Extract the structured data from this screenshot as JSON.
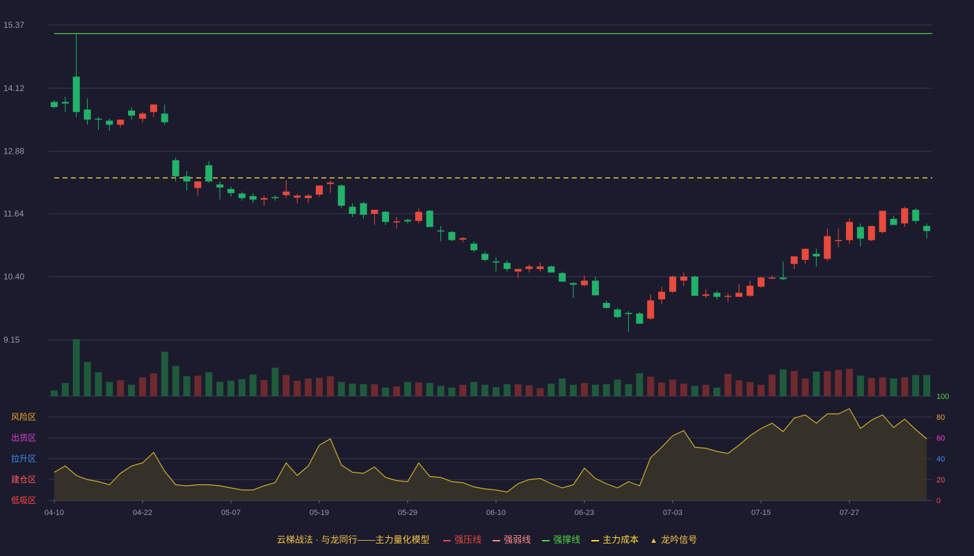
{
  "chart_data": {
    "type": "candlestick",
    "price_axis": {
      "ticks": [
        "15.37",
        "14.12",
        "12.88",
        "11.64",
        "10.40",
        "9.15"
      ],
      "range": [
        9.15,
        15.37
      ]
    },
    "dates": [
      "04-10",
      "04-11",
      "04-14",
      "04-15",
      "04-16",
      "04-17",
      "04-18",
      "04-21",
      "04-22",
      "04-23",
      "04-24",
      "04-25",
      "04-28",
      "04-29",
      "04-30",
      "05-06",
      "05-07",
      "05-08",
      "05-09",
      "05-12",
      "05-13",
      "05-14",
      "05-15",
      "05-16",
      "05-19",
      "05-20",
      "05-21",
      "05-22",
      "05-23",
      "05-26",
      "05-27",
      "05-28",
      "05-29",
      "05-30",
      "06-03",
      "06-04",
      "06-05",
      "06-06",
      "06-09",
      "06-10",
      "06-11",
      "06-12",
      "06-13",
      "06-16",
      "06-17",
      "06-18",
      "06-19",
      "06-20",
      "06-23",
      "06-24",
      "06-25",
      "06-26",
      "06-27",
      "06-30",
      "07-01",
      "07-02",
      "07-03",
      "07-04",
      "07-07",
      "07-08",
      "07-09",
      "07-10",
      "07-11",
      "07-14",
      "07-15",
      "07-16",
      "07-17",
      "07-18",
      "07-21",
      "07-22",
      "07-23",
      "07-24",
      "07-25",
      "07-28",
      "07-29",
      "07-30",
      "07-31",
      "08-01",
      "08-04",
      "08-05"
    ],
    "x_tick_labels": [
      "04-10",
      "04-22",
      "05-07",
      "05-19",
      "05-29",
      "06-10",
      "06-23",
      "07-03",
      "07-15",
      "07-27"
    ],
    "x_tick_indices": [
      0,
      8,
      16,
      24,
      32,
      40,
      48,
      56,
      64,
      72
    ],
    "ohlc": [
      [
        13.85,
        13.88,
        13.72,
        13.75
      ],
      [
        13.85,
        13.95,
        13.65,
        13.82
      ],
      [
        14.35,
        15.2,
        13.55,
        13.65
      ],
      [
        13.7,
        13.92,
        13.4,
        13.5
      ],
      [
        13.52,
        13.55,
        13.3,
        13.5
      ],
      [
        13.48,
        13.52,
        13.28,
        13.4
      ],
      [
        13.4,
        13.5,
        13.35,
        13.5
      ],
      [
        13.68,
        13.75,
        13.5,
        13.58
      ],
      [
        13.52,
        13.65,
        13.45,
        13.62
      ],
      [
        13.65,
        13.78,
        13.55,
        13.8
      ],
      [
        13.62,
        13.8,
        13.4,
        13.45
      ],
      [
        12.7,
        12.75,
        12.28,
        12.38
      ],
      [
        12.38,
        12.48,
        12.1,
        12.28
      ],
      [
        12.15,
        12.28,
        12.0,
        12.28
      ],
      [
        12.6,
        12.68,
        12.25,
        12.28
      ],
      [
        12.22,
        12.28,
        11.92,
        12.16
      ],
      [
        12.13,
        12.18,
        11.98,
        12.05
      ],
      [
        12.04,
        12.08,
        11.9,
        11.95
      ],
      [
        11.99,
        12.05,
        11.85,
        11.92
      ],
      [
        11.92,
        12.0,
        11.8,
        11.95
      ],
      [
        11.97,
        12.0,
        11.9,
        11.95
      ],
      [
        12.01,
        12.3,
        11.95,
        12.08
      ],
      [
        11.96,
        12.03,
        11.85,
        12.0
      ],
      [
        11.95,
        12.03,
        11.85,
        12.0
      ],
      [
        12.02,
        12.2,
        11.98,
        12.2
      ],
      [
        12.23,
        12.3,
        12.05,
        12.26
      ],
      [
        12.2,
        12.22,
        11.75,
        11.8
      ],
      [
        11.78,
        11.85,
        11.58,
        11.64
      ],
      [
        11.85,
        11.88,
        11.55,
        11.62
      ],
      [
        11.64,
        11.72,
        11.42,
        11.72
      ],
      [
        11.68,
        11.7,
        11.42,
        11.48
      ],
      [
        11.48,
        11.58,
        11.35,
        11.49
      ],
      [
        11.52,
        11.55,
        11.45,
        11.49
      ],
      [
        11.5,
        11.75,
        11.45,
        11.68
      ],
      [
        11.7,
        11.72,
        11.38,
        11.38
      ],
      [
        11.31,
        11.4,
        11.1,
        11.3
      ],
      [
        11.28,
        11.3,
        11.1,
        11.12
      ],
      [
        11.13,
        11.18,
        11.08,
        11.16
      ],
      [
        11.05,
        11.1,
        10.88,
        10.92
      ],
      [
        10.85,
        10.9,
        10.7,
        10.73
      ],
      [
        10.7,
        10.78,
        10.5,
        10.68
      ],
      [
        10.67,
        10.72,
        10.5,
        10.55
      ],
      [
        10.5,
        10.54,
        10.37,
        10.55
      ],
      [
        10.55,
        10.64,
        10.48,
        10.6
      ],
      [
        10.55,
        10.68,
        10.5,
        10.6
      ],
      [
        10.6,
        10.62,
        10.48,
        10.48
      ],
      [
        10.47,
        10.5,
        10.35,
        10.3
      ],
      [
        10.27,
        10.29,
        9.98,
        10.24
      ],
      [
        10.23,
        10.42,
        10.2,
        10.32
      ],
      [
        10.32,
        10.4,
        10.03,
        10.03
      ],
      [
        9.88,
        9.92,
        9.77,
        9.78
      ],
      [
        9.75,
        9.78,
        9.58,
        9.6
      ],
      [
        9.68,
        9.72,
        9.31,
        9.67
      ],
      [
        9.67,
        9.7,
        9.47,
        9.47
      ],
      [
        9.57,
        10.05,
        9.55,
        9.93
      ],
      [
        9.95,
        10.2,
        9.85,
        10.1
      ],
      [
        10.1,
        10.42,
        10.08,
        10.4
      ],
      [
        10.32,
        10.48,
        10.22,
        10.4
      ],
      [
        10.4,
        10.42,
        10.02,
        10.02
      ],
      [
        10.02,
        10.15,
        9.98,
        10.05
      ],
      [
        10.08,
        10.12,
        9.95,
        10.0
      ],
      [
        10.0,
        10.08,
        9.9,
        10.02
      ],
      [
        10.0,
        10.25,
        10.0,
        10.08
      ],
      [
        10.02,
        10.32,
        10.0,
        10.22
      ],
      [
        10.2,
        10.4,
        10.18,
        10.38
      ],
      [
        10.38,
        10.42,
        10.35,
        10.38
      ],
      [
        10.38,
        10.7,
        10.33,
        10.35
      ],
      [
        10.65,
        10.75,
        10.55,
        10.8
      ],
      [
        10.73,
        10.95,
        10.65,
        10.95
      ],
      [
        10.85,
        10.95,
        10.6,
        10.8
      ],
      [
        10.75,
        11.35,
        10.7,
        11.2
      ],
      [
        11.12,
        11.35,
        10.98,
        11.12
      ],
      [
        11.12,
        11.55,
        11.05,
        11.48
      ],
      [
        11.38,
        11.45,
        11.0,
        11.15
      ],
      [
        11.12,
        11.4,
        11.1,
        11.4
      ],
      [
        11.28,
        11.7,
        11.25,
        11.7
      ],
      [
        11.54,
        11.6,
        11.42,
        11.42
      ],
      [
        11.45,
        11.78,
        11.38,
        11.75
      ],
      [
        11.72,
        11.75,
        11.45,
        11.5
      ],
      [
        11.4,
        11.45,
        11.15,
        11.3
      ]
    ],
    "volume": [
      10,
      23,
      100,
      60,
      42,
      25,
      28,
      20,
      33,
      40,
      78,
      53,
      35,
      36,
      42,
      25,
      27,
      30,
      38,
      28,
      50,
      37,
      27,
      31,
      32,
      35,
      25,
      22,
      21,
      21,
      15,
      17,
      25,
      24,
      23,
      18,
      15,
      20,
      25,
      20,
      16,
      21,
      21,
      19,
      14,
      22,
      31,
      20,
      23,
      20,
      21,
      29,
      21,
      40,
      34,
      24,
      29,
      22,
      18,
      20,
      15,
      39,
      28,
      25,
      20,
      38,
      47,
      44,
      31,
      43,
      44,
      46,
      48,
      36,
      32,
      33,
      31,
      33,
      37,
      37
    ],
    "lines": [
      {
        "name": "强撑线",
        "value": 15.2,
        "color": "#50d43e"
      },
      {
        "name": "主力成本",
        "value": 12.35,
        "color": "#ffd93d"
      }
    ],
    "indicator": {
      "axis_ticks": [
        "100",
        "80",
        "60",
        "40",
        "20",
        "0"
      ],
      "axis_colors": [
        "#50d43e",
        "#f0a030",
        "#ff3cd5",
        "#3c8cff",
        "#ff5a5a",
        "#ff4545"
      ],
      "zones": [
        {
          "label": "风险区",
          "color": "#f5a623"
        },
        {
          "label": "出货区",
          "color": "#e23cd5"
        },
        {
          "label": "拉升区",
          "color": "#3b8cf0"
        },
        {
          "label": "建仓区",
          "color": "#ff5a5a"
        },
        {
          "label": "低吸区",
          "color": "#ff4545"
        }
      ],
      "values": [
        27,
        33,
        24,
        20,
        18,
        15,
        26,
        33,
        36,
        46,
        28,
        15,
        14,
        15,
        15,
        14,
        12,
        10,
        10,
        14,
        17,
        36,
        24,
        33,
        53,
        59,
        34,
        27,
        26,
        32,
        22,
        19,
        18,
        36,
        23,
        22,
        18,
        17,
        13,
        11,
        10,
        8,
        16,
        20,
        21,
        16,
        12,
        15,
        31,
        21,
        16,
        12,
        18,
        14,
        41,
        51,
        62,
        67,
        51,
        50,
        47,
        45,
        53,
        62,
        69,
        74,
        66,
        79,
        82,
        74,
        83,
        83,
        88,
        69,
        77,
        82,
        70,
        78,
        68,
        59
      ],
      "color": "#d4b22e"
    }
  },
  "legend": {
    "title": "云梯战法 · 与龙同行——主力量化模型",
    "items": [
      {
        "label": "强压线",
        "color": "#e84a3c",
        "style": "solid"
      },
      {
        "label": "强弱线",
        "color": "#ff8a8a",
        "style": "dash"
      },
      {
        "label": "强撑线",
        "color": "#50d43e",
        "style": "solid"
      },
      {
        "label": "主力成本",
        "color": "#ffd93d",
        "style": "dash"
      },
      {
        "label": "龙吟信号",
        "color": "#f5c542",
        "style": "triangle"
      }
    ]
  }
}
